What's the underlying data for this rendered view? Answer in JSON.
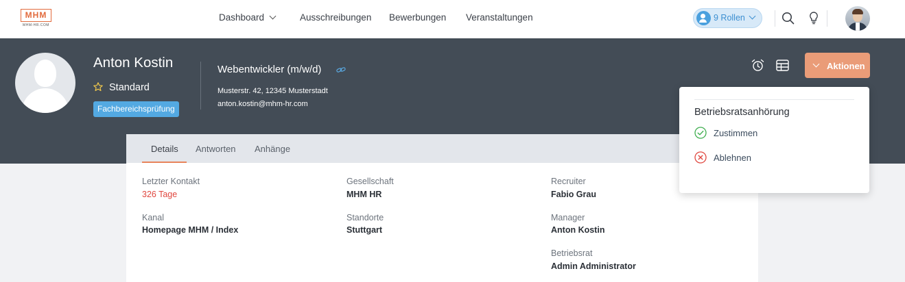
{
  "logo": {
    "text": "MHM",
    "subtext": "MHM-HR.COM"
  },
  "nav": {
    "dashboard": "Dashboard",
    "ausschreibungen": "Ausschreibungen",
    "bewerbungen": "Bewerbungen",
    "veranstaltungen": "Veranstaltungen"
  },
  "roles": {
    "label": "9 Rollen"
  },
  "profile": {
    "name": "Anton Kostin",
    "level": "Standard",
    "status_badge": "Fachbereichsprüfung",
    "job_title": "Webentwickler (m/w/d)",
    "address": "Musterstr. 42, 12345 Musterstadt",
    "email": "anton.kostin@mhm-hr.com"
  },
  "actions": {
    "label": "Aktionen"
  },
  "tabs": [
    "Details",
    "Antworten",
    "Anhänge"
  ],
  "details": {
    "col1": [
      {
        "label": "Letzter Kontakt",
        "value": "326 Tage"
      },
      {
        "label": "Kanal",
        "value": "Homepage MHM / Index"
      }
    ],
    "col2": [
      {
        "label": "Gesellschaft",
        "value": "MHM HR"
      },
      {
        "label": "Standorte",
        "value": "Stuttgart"
      }
    ],
    "col3": [
      {
        "label": "Recruiter",
        "value": "Fabio Grau"
      },
      {
        "label": "Manager",
        "value": "Anton Kostin"
      },
      {
        "label": "Betriebsrat",
        "value": "Admin Administrator"
      }
    ]
  },
  "dropdown": {
    "heading": "Betriebsratsanhörung",
    "approve": "Zustimmen",
    "reject": "Ablehnen"
  },
  "colors": {
    "accent": "#ea9c78",
    "header_band": "#434c56",
    "badge": "#53a9e2",
    "warning_red": "#e0473f",
    "approve_green": "#3fae4f"
  }
}
